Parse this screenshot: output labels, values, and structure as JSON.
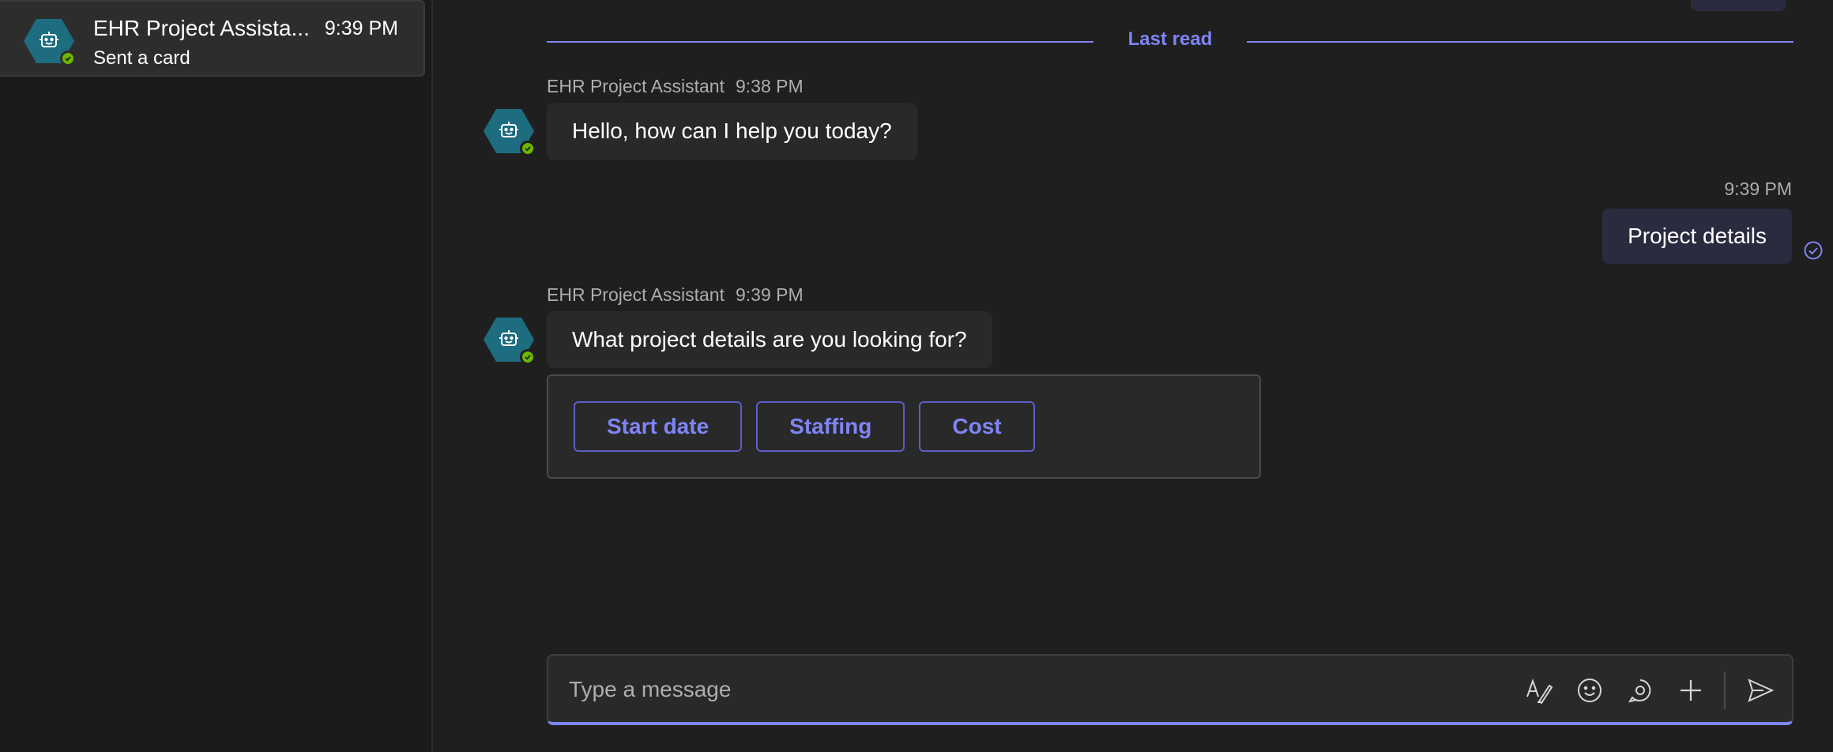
{
  "sidebar": {
    "chat_item": {
      "name": "EHR Project Assista...",
      "time": "9:39 PM",
      "preview": "Sent a card"
    }
  },
  "conversation": {
    "last_read_label": "Last read",
    "messages": [
      {
        "sender": "EHR Project Assistant",
        "time": "9:38 PM",
        "text": "Hello, how can I help you today?"
      },
      {
        "time": "9:39 PM",
        "text": "Project details"
      },
      {
        "sender": "EHR Project Assistant",
        "time": "9:39 PM",
        "text": "What project details are you looking for?"
      }
    ],
    "card_buttons": [
      "Start date",
      "Staffing",
      "Cost"
    ]
  },
  "compose": {
    "placeholder": "Type a message",
    "icons": [
      "format-icon",
      "emoji-icon",
      "loop-icon",
      "attach-icon",
      "send-icon"
    ]
  },
  "colors": {
    "accent": "#7f85f5",
    "avatar": "#1d6c80",
    "presence": "#6bb700"
  }
}
